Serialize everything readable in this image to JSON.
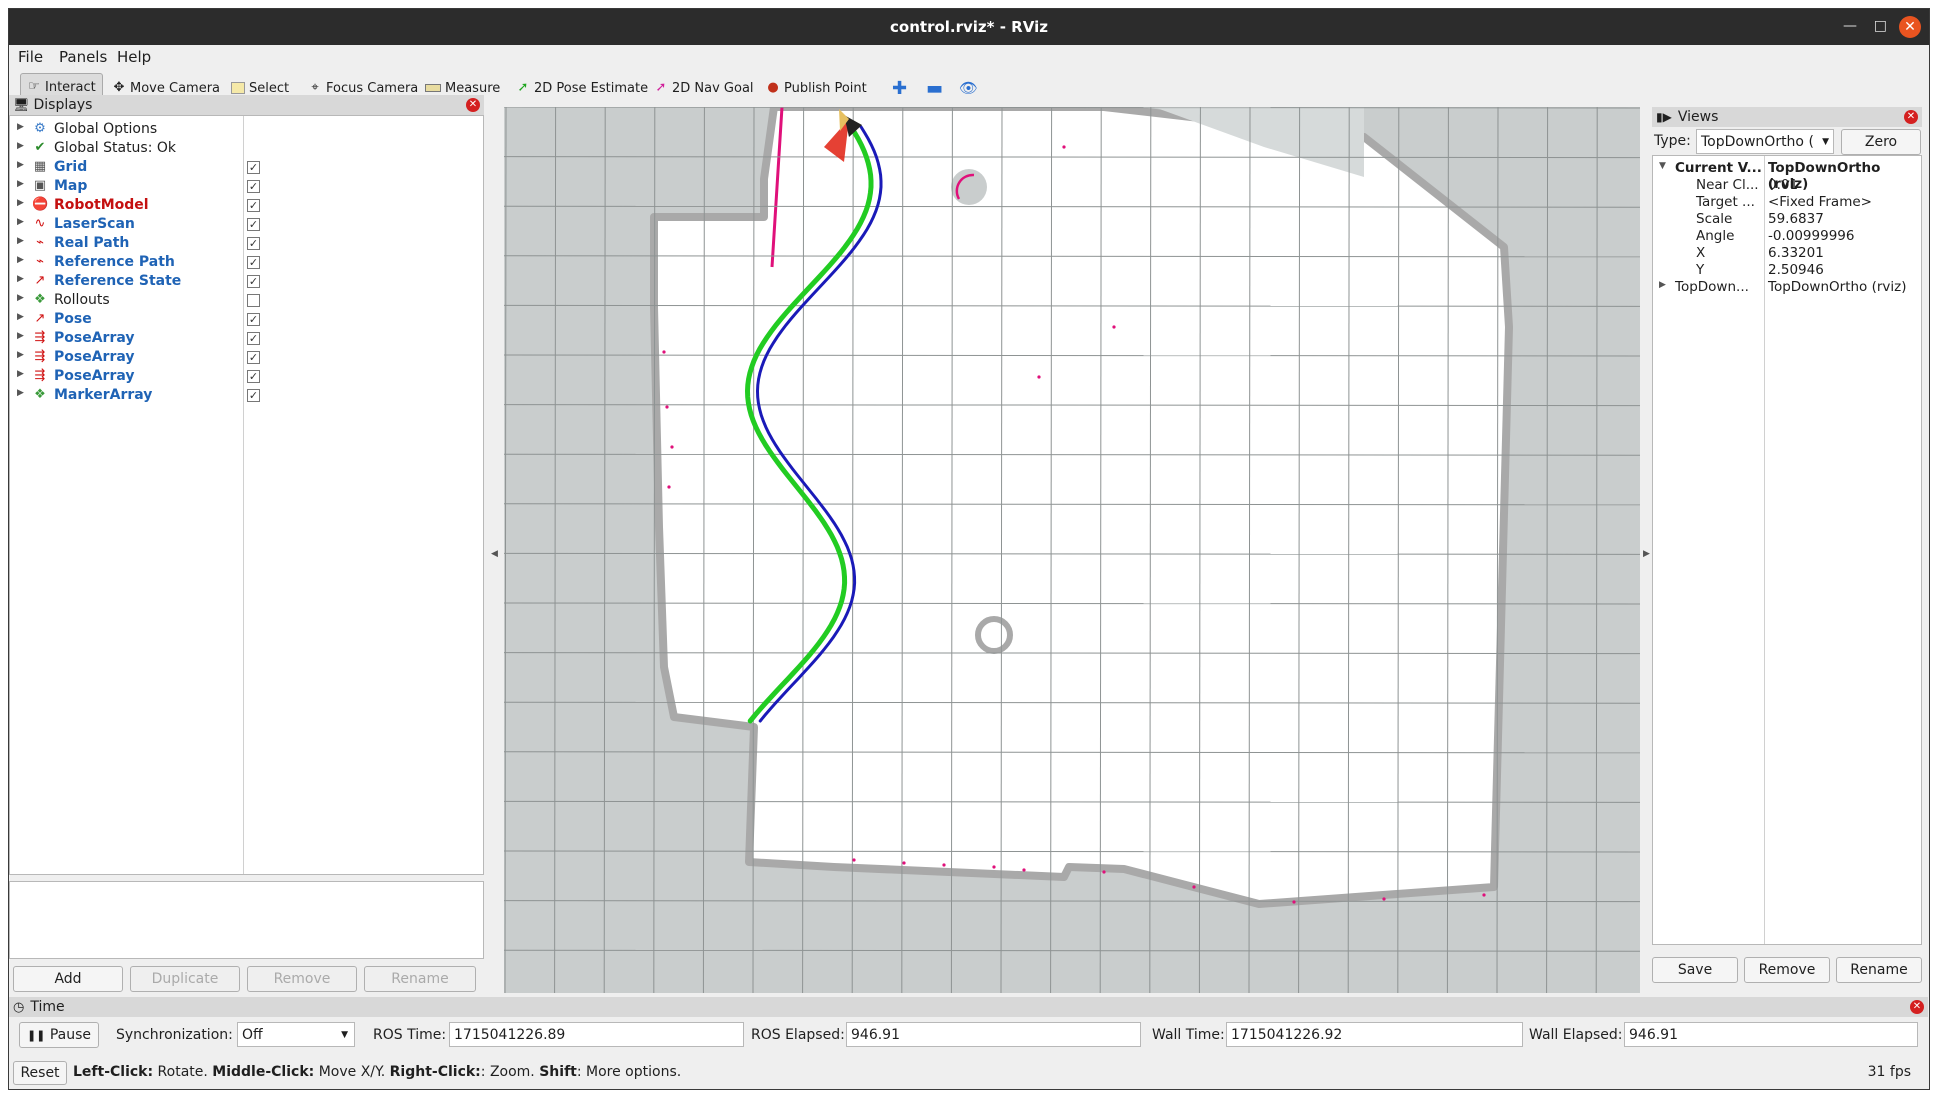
{
  "window": {
    "title": "control.rviz* - RViz"
  },
  "menubar": {
    "items": [
      "File",
      "Panels",
      "Help"
    ]
  },
  "toolbar": {
    "tools": [
      {
        "label": "Interact",
        "icon": "hand-pointer-icon"
      },
      {
        "label": "Move Camera",
        "icon": "move-camera-icon"
      },
      {
        "label": "Select",
        "icon": "select-box-icon"
      },
      {
        "label": "Focus Camera",
        "icon": "focus-crosshair-icon"
      },
      {
        "label": "Measure",
        "icon": "ruler-icon"
      },
      {
        "label": "2D Pose Estimate",
        "icon": "green-arrow-icon"
      },
      {
        "label": "2D Nav Goal",
        "icon": "magenta-arrow-icon"
      },
      {
        "label": "Publish Point",
        "icon": "map-pin-icon"
      }
    ]
  },
  "displays": {
    "title": "Displays",
    "items": [
      {
        "label": "Global Options",
        "checked": null,
        "style": "normal",
        "icon": "gear-icon"
      },
      {
        "label": "Global Status: Ok",
        "checked": null,
        "style": "normal",
        "icon": "checkmark-icon"
      },
      {
        "label": "Grid",
        "checked": true,
        "style": "blue",
        "icon": "grid-icon"
      },
      {
        "label": "Map",
        "checked": true,
        "style": "blue",
        "icon": "map-icon"
      },
      {
        "label": "RobotModel",
        "checked": true,
        "style": "red",
        "icon": "error-icon"
      },
      {
        "label": "LaserScan",
        "checked": true,
        "style": "blue",
        "icon": "laser-icon"
      },
      {
        "label": "Real Path",
        "checked": true,
        "style": "blue",
        "icon": "path-icon"
      },
      {
        "label": "Reference Path",
        "checked": true,
        "style": "blue",
        "icon": "path-icon"
      },
      {
        "label": "Reference State",
        "checked": true,
        "style": "blue",
        "icon": "pose-arrow-icon"
      },
      {
        "label": "Rollouts",
        "checked": false,
        "style": "normal",
        "icon": "marker-icon"
      },
      {
        "label": "Pose",
        "checked": true,
        "style": "blue",
        "icon": "pose-arrow-icon"
      },
      {
        "label": "PoseArray",
        "checked": true,
        "style": "blue",
        "icon": "pose-array-icon"
      },
      {
        "label": "PoseArray",
        "checked": true,
        "style": "blue",
        "icon": "pose-array-icon"
      },
      {
        "label": "PoseArray",
        "checked": true,
        "style": "blue",
        "icon": "pose-array-icon"
      },
      {
        "label": "MarkerArray",
        "checked": true,
        "style": "blue",
        "icon": "marker-icon"
      }
    ],
    "buttons": {
      "add": "Add",
      "duplicate": "Duplicate",
      "remove": "Remove",
      "rename": "Rename"
    }
  },
  "views": {
    "title": "Views",
    "type_label": "Type:",
    "type_value": "TopDownOrtho (",
    "zero": "Zero",
    "rows": [
      {
        "key": "Current V...",
        "value": "TopDownOrtho (rviz)",
        "bold": true,
        "expanded": true
      },
      {
        "key": "Near Cl...",
        "value": "0.01"
      },
      {
        "key": "Target ...",
        "value": "<Fixed Frame>"
      },
      {
        "key": "Scale",
        "value": "59.6837"
      },
      {
        "key": "Angle",
        "value": "-0.00999996"
      },
      {
        "key": "X",
        "value": "6.33201"
      },
      {
        "key": "Y",
        "value": "2.50946"
      },
      {
        "key": "TopDown...",
        "value": "TopDownOrtho (rviz)",
        "collapsed": true
      }
    ],
    "buttons": {
      "save": "Save",
      "remove": "Remove",
      "rename": "Rename"
    }
  },
  "time": {
    "title": "Time",
    "pause": "Pause",
    "sync_label": "Synchronization:",
    "sync_value": "Off",
    "ros_time_label": "ROS Time:",
    "ros_time": "1715041226.89",
    "ros_elapsed_label": "ROS Elapsed:",
    "ros_elapsed": "946.91",
    "wall_time_label": "Wall Time:",
    "wall_time": "1715041226.92",
    "wall_elapsed_label": "Wall Elapsed:",
    "wall_elapsed": "946.91"
  },
  "statusbar": {
    "reset": "Reset",
    "hint1_b": "Left-Click:",
    "hint1": " Rotate. ",
    "hint2_b": "Middle-Click:",
    "hint2": " Move X/Y. ",
    "hint3_b": "Right-Click:",
    "hint3": ": Zoom. ",
    "hint4_b": "Shift",
    "hint4": ": More options.",
    "fps": "31 fps"
  },
  "colors": {
    "reference_path": "#1a1ab8",
    "real_path": "#22cc22",
    "laser": "#e0107a",
    "robot": "#e02010"
  }
}
